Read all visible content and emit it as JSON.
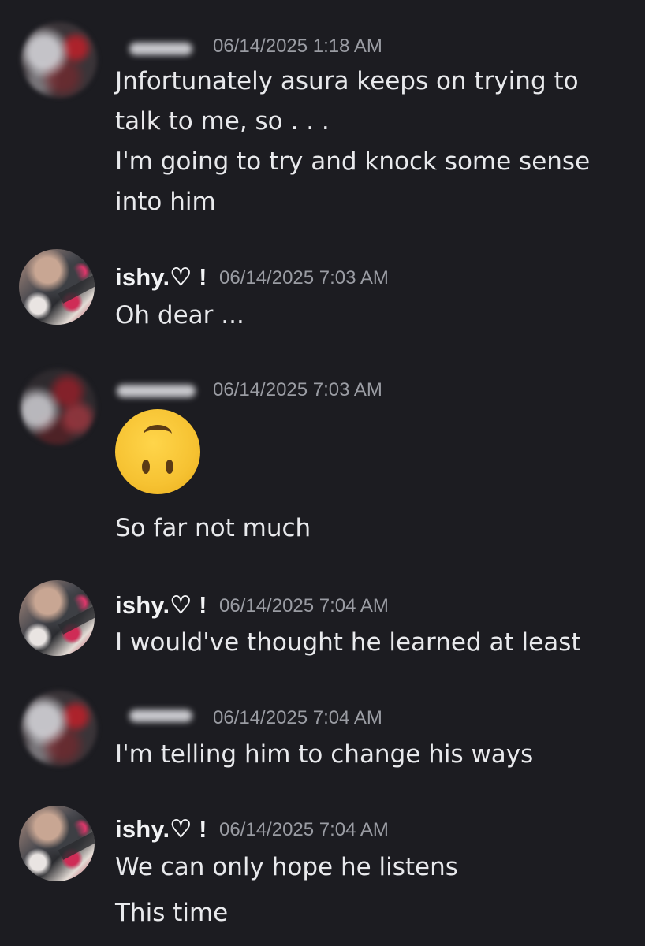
{
  "messages": [
    {
      "author": "",
      "timestamp": "06/14/2025 1:18 AM",
      "lines": [
        "Jnfortunately asura keeps on trying to",
        "talk to me, so . . .",
        "I'm going to try and knock some sense",
        "into him"
      ]
    },
    {
      "author": "ishy.♡ !",
      "timestamp": "06/14/2025 7:03 AM",
      "lines": [
        "Oh dear ..."
      ]
    },
    {
      "author": "",
      "timestamp": "06/14/2025 7:03 AM",
      "emoji": "upside-down-face",
      "lines": [
        "So far not much"
      ]
    },
    {
      "author": "ishy.♡ !",
      "timestamp": "06/14/2025 7:04 AM",
      "lines": [
        "I would've thought he learned at least"
      ]
    },
    {
      "author": "",
      "timestamp": "06/14/2025 7:04 AM",
      "lines": [
        "I'm telling him to change his ways"
      ]
    },
    {
      "author": "ishy.♡ !",
      "timestamp": "06/14/2025 7:04 AM",
      "lines": [
        "We can only hope he listens",
        "This time"
      ]
    }
  ],
  "colors": {
    "background": "#1c1c21",
    "username": "#f2f3f5",
    "timestamp": "#9a9ca3",
    "message": "#e8e9ec"
  }
}
